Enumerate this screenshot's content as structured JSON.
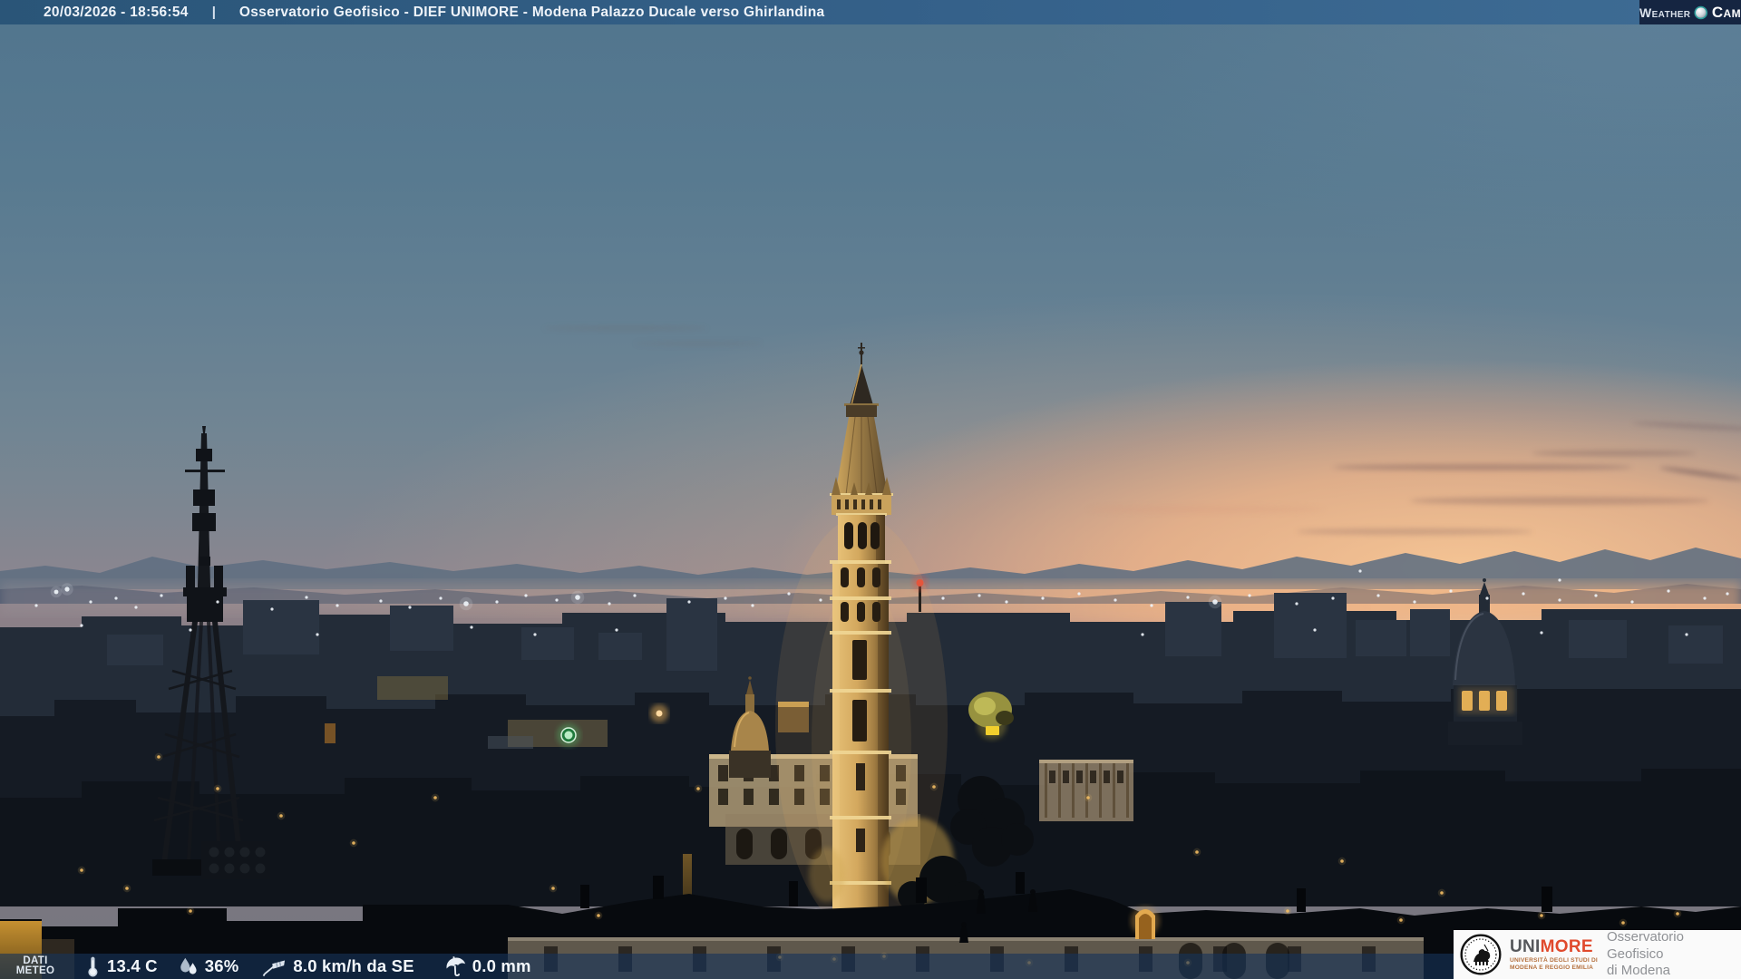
{
  "top_bar": {
    "datetime": "20/03/2026 - 18:56:54",
    "separator": "|",
    "title": "Osservatorio Geofisico - DIEF UNIMORE - Modena Palazzo Ducale verso Ghirlandina",
    "logo": {
      "word1": "Weather",
      "word2": "Cam"
    }
  },
  "weather_bar": {
    "label_line1": "DATI",
    "label_line2": "METEO",
    "temperature": "13.4 C",
    "humidity": "36%",
    "wind": "8.0 km/h da SE",
    "precipitation": "0.0 mm"
  },
  "brand_box": {
    "wordmark_uni": "UNI",
    "wordmark_more": "MORE",
    "subtitle_line1": "UNIVERSITÀ DEGLI STUDI DI",
    "subtitle_line2": "MODENA E REGGIO EMILIA",
    "org_line1": "Osservatorio Geofisico",
    "org_line2": "di Modena"
  },
  "colors": {
    "topbar_blue": "#2f5c82",
    "logo_navy": "#152541",
    "bar_navy": "rgba(22,51,88,.62)",
    "sky_top": "#51758e",
    "sunset_glow": "#f3b585",
    "tower_gold": "#d9ae62",
    "brand_red": "#e04a2d",
    "brand_gray": "#8f9195"
  }
}
